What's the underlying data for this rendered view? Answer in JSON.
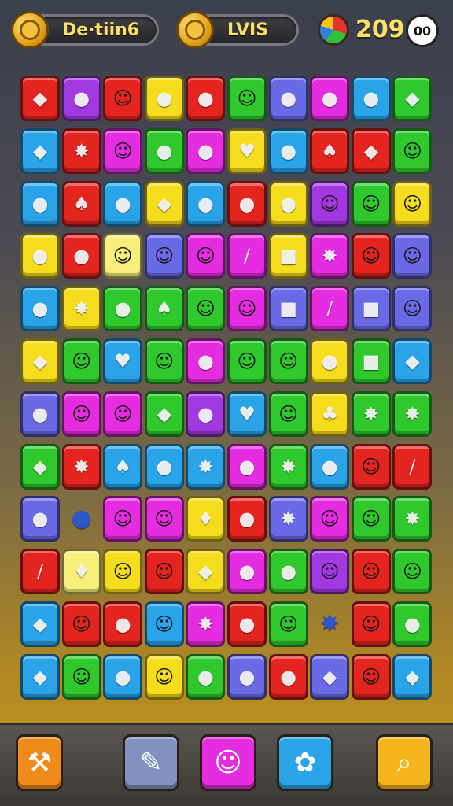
{
  "hud": {
    "left_label": "De·tiin6",
    "mid_label": "LVIS",
    "score": "209",
    "badge": "00",
    "icons": [
      "coin-icon",
      "trophy-coin-icon",
      "color-orb-icon"
    ]
  },
  "colors": {
    "R": "#e3241f",
    "P": "#a238e0",
    "Y": "#f5dc1c",
    "G": "#2fc82d",
    "B": "#2aa4e8",
    "M": "#e52ce0",
    "V": "#6a6ae6",
    "O": "#f08a1a",
    "W": "#ffffff",
    "L": "#f7ef7a"
  },
  "board": [
    [
      [
        "R",
        "◆"
      ],
      [
        "P",
        "●"
      ],
      [
        "R",
        "☺"
      ],
      [
        "Y",
        "●"
      ],
      [
        "R",
        "●"
      ],
      [
        "G",
        "☺"
      ],
      [
        "V",
        "●"
      ],
      [
        "M",
        "●"
      ],
      [
        "B",
        "●"
      ],
      [
        "G",
        "◆"
      ]
    ],
    [
      [
        "B",
        "◆"
      ],
      [
        "R",
        "✸"
      ],
      [
        "M",
        "☺"
      ],
      [
        "G",
        "●"
      ],
      [
        "M",
        "●"
      ],
      [
        "Y",
        "♥"
      ],
      [
        "B",
        "●"
      ],
      [
        "R",
        "♠"
      ],
      [
        "R",
        "◆"
      ],
      [
        "G",
        "☺"
      ]
    ],
    [
      [
        "B",
        "●"
      ],
      [
        "R",
        "♠"
      ],
      [
        "B",
        "●"
      ],
      [
        "Y",
        "◆"
      ],
      [
        "B",
        "●"
      ],
      [
        "R",
        "●"
      ],
      [
        "Y",
        "●"
      ],
      [
        "P",
        "☺"
      ],
      [
        "G",
        "☺"
      ],
      [
        "Y",
        "☺"
      ]
    ],
    [
      [
        "Y",
        "●"
      ],
      [
        "R",
        "●"
      ],
      [
        "L",
        "☺"
      ],
      [
        "V",
        "☺"
      ],
      [
        "M",
        "☺"
      ],
      [
        "M",
        "/"
      ],
      [
        "Y",
        "■"
      ],
      [
        "M",
        "✸"
      ],
      [
        "R",
        "☺"
      ],
      [
        "V",
        "☺"
      ]
    ],
    [
      [
        "B",
        "●"
      ],
      [
        "Y",
        "✸"
      ],
      [
        "G",
        "●"
      ],
      [
        "G",
        "♠"
      ],
      [
        "G",
        "☺"
      ],
      [
        "M",
        "☺"
      ],
      [
        "V",
        "■"
      ],
      [
        "M",
        "/"
      ],
      [
        "V",
        "■"
      ],
      [
        "V",
        "☺"
      ]
    ],
    [
      [
        "Y",
        "◆"
      ],
      [
        "G",
        "☺"
      ],
      [
        "B",
        "♥"
      ],
      [
        "G",
        "☺"
      ],
      [
        "M",
        "●"
      ],
      [
        "G",
        "☺"
      ],
      [
        "G",
        "☺"
      ],
      [
        "Y",
        "●"
      ],
      [
        "G",
        "■"
      ],
      [
        "B",
        "◆"
      ]
    ],
    [
      [
        "V",
        "●"
      ],
      [
        "M",
        "☺"
      ],
      [
        "M",
        "☺"
      ],
      [
        "G",
        "◆"
      ],
      [
        "P",
        "●"
      ],
      [
        "B",
        "♥"
      ],
      [
        "G",
        "☺"
      ],
      [
        "Y",
        "♣"
      ],
      [
        "G",
        "✸"
      ],
      [
        "G",
        "✸"
      ]
    ],
    [
      [
        "G",
        "◆"
      ],
      [
        "R",
        "✸"
      ],
      [
        "B",
        "♠"
      ],
      [
        "B",
        "●"
      ],
      [
        "B",
        "✸"
      ],
      [
        "M",
        "●"
      ],
      [
        "G",
        "✸"
      ],
      [
        "B",
        "●"
      ],
      [
        "R",
        "☺"
      ],
      [
        "R",
        "/"
      ]
    ],
    [
      [
        "V",
        "●"
      ],
      [
        "E",
        "●"
      ],
      [
        "M",
        "☺"
      ],
      [
        "M",
        "☺"
      ],
      [
        "Y",
        "♦"
      ],
      [
        "R",
        "●"
      ],
      [
        "V",
        "✸"
      ],
      [
        "M",
        "☺"
      ],
      [
        "G",
        "☺"
      ],
      [
        "G",
        "✸"
      ]
    ],
    [
      [
        "R",
        "/"
      ],
      [
        "L",
        "♦"
      ],
      [
        "Y",
        "☺"
      ],
      [
        "R",
        "☺"
      ],
      [
        "Y",
        "◆"
      ],
      [
        "M",
        "●"
      ],
      [
        "G",
        "●"
      ],
      [
        "P",
        "☺"
      ],
      [
        "R",
        "☺"
      ],
      [
        "G",
        "☺"
      ]
    ],
    [
      [
        "B",
        "◆"
      ],
      [
        "R",
        "☺"
      ],
      [
        "R",
        "●"
      ],
      [
        "B",
        "☺"
      ],
      [
        "M",
        "✸"
      ],
      [
        "R",
        "●"
      ],
      [
        "G",
        "☺"
      ],
      [
        "E",
        "✸"
      ],
      [
        "R",
        "☺"
      ],
      [
        "G",
        "●"
      ]
    ],
    [
      [
        "B",
        "◆"
      ],
      [
        "G",
        "☺"
      ],
      [
        "B",
        "●"
      ],
      [
        "Y",
        "☺"
      ],
      [
        "G",
        "●"
      ],
      [
        "V",
        "●"
      ],
      [
        "R",
        "●"
      ],
      [
        "V",
        "◆"
      ],
      [
        "R",
        "☺"
      ],
      [
        "B",
        "◆"
      ]
    ]
  ],
  "toolbar": [
    {
      "name": "hammer-tool-button",
      "icon": "hammer-icon",
      "color": "#f08a1a",
      "glyph": "⚒"
    },
    {
      "name": "pencil-tool-button",
      "icon": "pencil-icon",
      "color": "#8093c0",
      "glyph": "✎"
    },
    {
      "name": "smiley-tool-button",
      "icon": "smiley-icon",
      "color": "#e52ce0",
      "glyph": "☺"
    },
    {
      "name": "cog-face-tool-button",
      "icon": "cog-face-icon",
      "color": "#2aa4e8",
      "glyph": "✿"
    },
    {
      "name": "search-tool-button",
      "icon": "magnifier-icon",
      "color": "#f5b51c",
      "glyph": "⌕"
    }
  ]
}
